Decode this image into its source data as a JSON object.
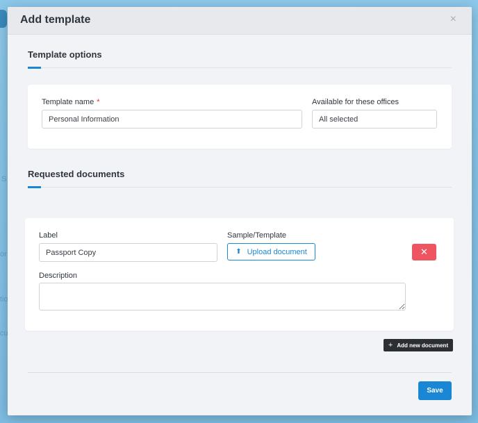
{
  "background": {
    "fragments": [
      "S",
      "or",
      "tio",
      "cu"
    ]
  },
  "modal": {
    "title": "Add template",
    "close_symbol": "×"
  },
  "template_options": {
    "heading": "Template options",
    "name_label": "Template name",
    "required_mark": "*",
    "name_value": "Personal Information",
    "offices_label": "Available for these offices",
    "offices_value": "All selected"
  },
  "requested_documents": {
    "heading": "Requested documents",
    "documents": [
      {
        "label_label": "Label",
        "label_value": "Passport Copy",
        "sample_label": "Sample/Template",
        "upload_label": "Upload document",
        "description_label": "Description",
        "description_value": ""
      }
    ],
    "add_label": "Add new document"
  },
  "footer": {
    "save_label": "Save"
  },
  "icons": {
    "close": "close-icon",
    "upload": "upload-icon",
    "delete": "delete-icon",
    "add": "plus-icon"
  },
  "colors": {
    "accent": "#1a87d4",
    "danger": "#ee5560",
    "dark_button": "#2b2f33",
    "required": "#e02f36"
  }
}
